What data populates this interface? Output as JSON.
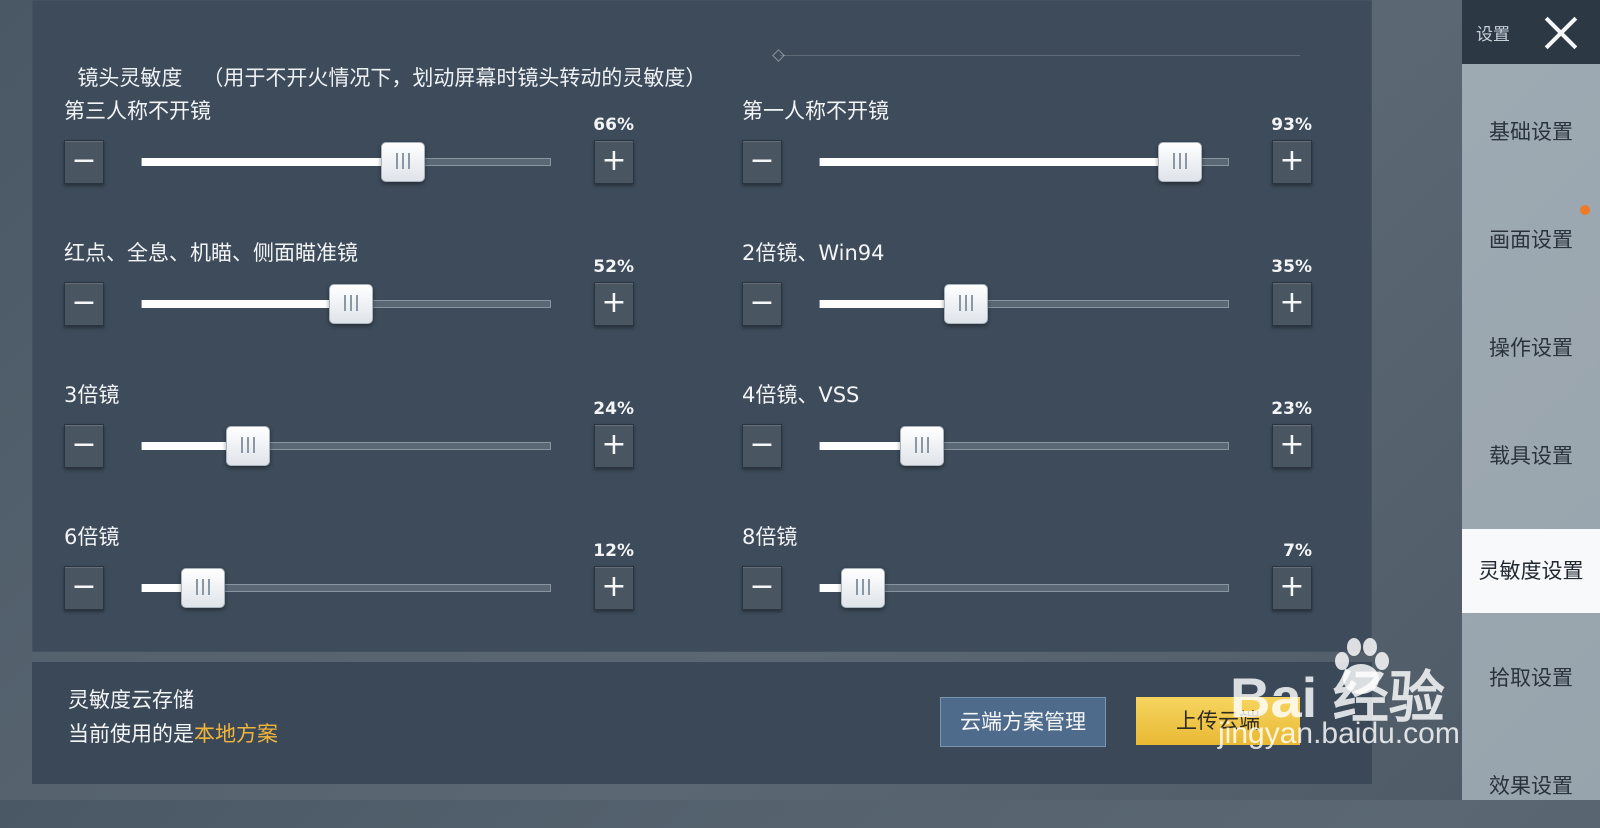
{
  "header": {
    "title": "镜头灵敏度",
    "note": "（用于不开火情况下，划动屏幕时镜头转动的灵敏度）"
  },
  "sliders": [
    {
      "label": "第三人称不开镜",
      "value_text": "66%",
      "value": 66
    },
    {
      "label": "第一人称不开镜",
      "value_text": "93%",
      "value": 93
    },
    {
      "label": "红点、全息、机瞄、侧面瞄准镜",
      "value_text": "52%",
      "value": 52
    },
    {
      "label": "2倍镜、Win94",
      "value_text": "35%",
      "value": 35
    },
    {
      "label": "3倍镜",
      "value_text": "24%",
      "value": 24
    },
    {
      "label": "4倍镜、VSS",
      "value_text": "23%",
      "value": 23
    },
    {
      "label": "6倍镜",
      "value_text": "12%",
      "value": 12
    },
    {
      "label": "8倍镜",
      "value_text": "7%",
      "value": 7
    }
  ],
  "stepper": {
    "minus": "−",
    "plus": "+"
  },
  "cloud": {
    "title": "灵敏度云存储",
    "status_prefix": "当前使用的是",
    "status_scheme": "本地方案",
    "manage_button": "云端方案管理",
    "upload_button": "上传云端"
  },
  "sidebar": {
    "title": "设置",
    "items": [
      {
        "label": "基础设置"
      },
      {
        "label": "画面设置"
      },
      {
        "label": "操作设置"
      },
      {
        "label": "载具设置"
      },
      {
        "label": "灵敏度设置"
      },
      {
        "label": "拾取设置"
      },
      {
        "label": "效果设置"
      }
    ],
    "active": "灵敏度设置"
  },
  "watermark": {
    "brand": "Bai  经验",
    "url": "jingyan.baidu.com"
  },
  "colors": {
    "accent": "#f2b53c",
    "active_tab_bg": "#f7f9fb",
    "notice_dot": "#ef7a2a"
  }
}
